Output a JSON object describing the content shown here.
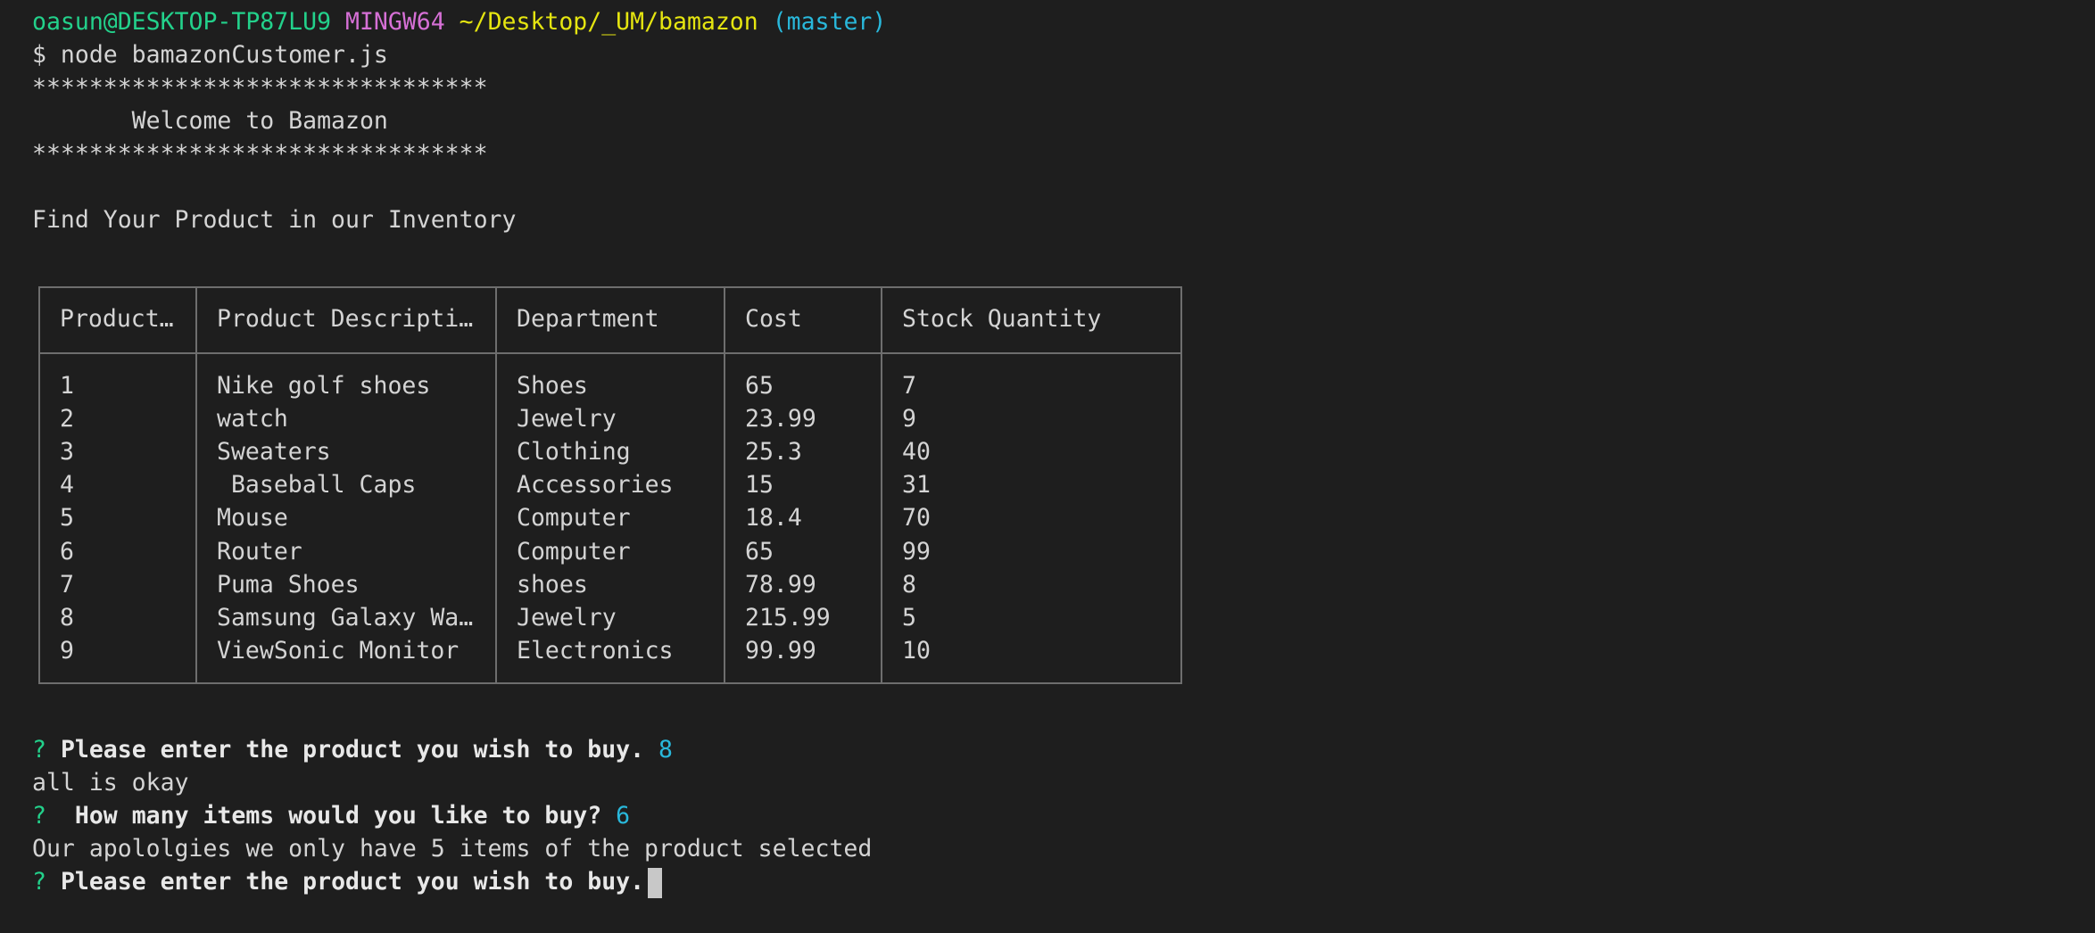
{
  "prompt": {
    "user_host": "oasun@DESKTOP-TP87LU9",
    "shell": "MINGW64",
    "path": "~/Desktop/_UM/bamazon",
    "branch": "(master)",
    "command": "$ node bamazonCustomer.js"
  },
  "banner": {
    "stars": "********************************",
    "welcome": "       Welcome to Bamazon"
  },
  "find_text": "Find Your Product in our Inventory",
  "table": {
    "headers": [
      "Product…",
      "Product Descripti…",
      "Department",
      "Cost",
      "Stock Quantity"
    ],
    "rows": [
      [
        "1",
        "Nike golf shoes",
        "Shoes",
        "65",
        "7"
      ],
      [
        "2",
        "watch",
        "Jewelry",
        "23.99",
        "9"
      ],
      [
        "3",
        "Sweaters",
        "Clothing",
        "25.3",
        "40"
      ],
      [
        "4",
        " Baseball Caps",
        "Accessories",
        "15",
        "31"
      ],
      [
        "5",
        "Mouse",
        "Computer",
        "18.4",
        "70"
      ],
      [
        "6",
        "Router",
        "Computer",
        "65",
        "99"
      ],
      [
        "7",
        "Puma Shoes",
        "shoes",
        "78.99",
        "8"
      ],
      [
        "8",
        "Samsung Galaxy Wa…",
        "Jewelry",
        "215.99",
        "5"
      ],
      [
        "9",
        "ViewSonic Monitor",
        "Electronics",
        "99.99",
        "10"
      ]
    ]
  },
  "session": {
    "q1_mark": "?",
    "q1_text": "Please enter the product you wish to buy.",
    "q1_answer": "8",
    "resp1": "all is okay",
    "q2_mark": "?",
    "q2_text": " How many items would you like to buy?",
    "q2_answer": "6",
    "resp2": "Our apololgies we only have 5 items of the product selected",
    "q3_mark": "?",
    "q3_text": "Please enter the product you wish to buy."
  },
  "colors": {
    "background": "#1e1e1e",
    "text": "#d4d4d4",
    "green": "#23d18b",
    "magenta": "#d670d6",
    "yellow": "#e5e510",
    "cyan": "#29b8db"
  }
}
